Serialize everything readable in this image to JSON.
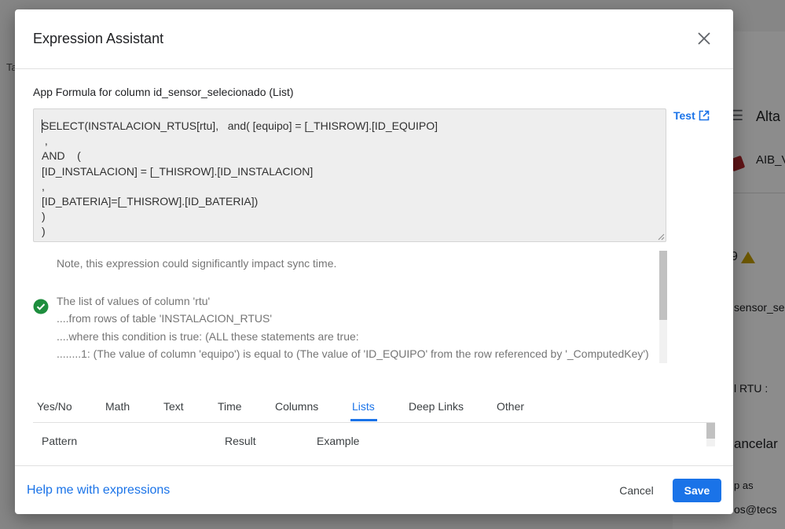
{
  "dialog": {
    "title": "Expression Assistant",
    "column_label": "App Formula for column id_sensor_selecionado (List)",
    "formula_lines": [
      "SELECT(INSTALACION_RTUS[rtu],   and( [equipo] = [_THISROW].[ID_EQUIPO]",
      " ,",
      "AND    (",
      "[ID_INSTALACION] = [_THISROW].[ID_INSTALACION]",
      ",",
      "[ID_BATERIA]=[_THISROW].[ID_BATERIA])",
      ")",
      ")"
    ],
    "test_label": "Test",
    "note": "Note, this expression could significantly impact sync time.",
    "explanation": [
      "The list of values of column 'rtu'",
      "....from rows of table 'INSTALACION_RTUS'",
      "....where this condition is true: (ALL these statements are true:",
      "........1: (The value of column 'equipo') is equal to (The value of 'ID_EQUIPO' from the row referenced by '_ComputedKey')"
    ],
    "tabs": [
      "Yes/No",
      "Math",
      "Text",
      "Time",
      "Columns",
      "Lists",
      "Deep Links",
      "Other"
    ],
    "active_tab": "Lists",
    "table_headers": [
      "Pattern",
      "Result",
      "Example"
    ],
    "footer": {
      "help": "Help me with expressions",
      "cancel": "Cancel",
      "save": "Save"
    }
  },
  "background": {
    "alta": "Alta",
    "aib": "AIB_V",
    "sensor": "sensor_selecio",
    "rtu": "l RTU :",
    "cancelar": "ancelar",
    "op_as": "p as",
    "email": "os@tecs",
    "ta": "Ta",
    "nine": "9"
  },
  "colors": {
    "accent": "#1a73e8",
    "success": "#1e8e3e",
    "warning": "#c6a000"
  }
}
